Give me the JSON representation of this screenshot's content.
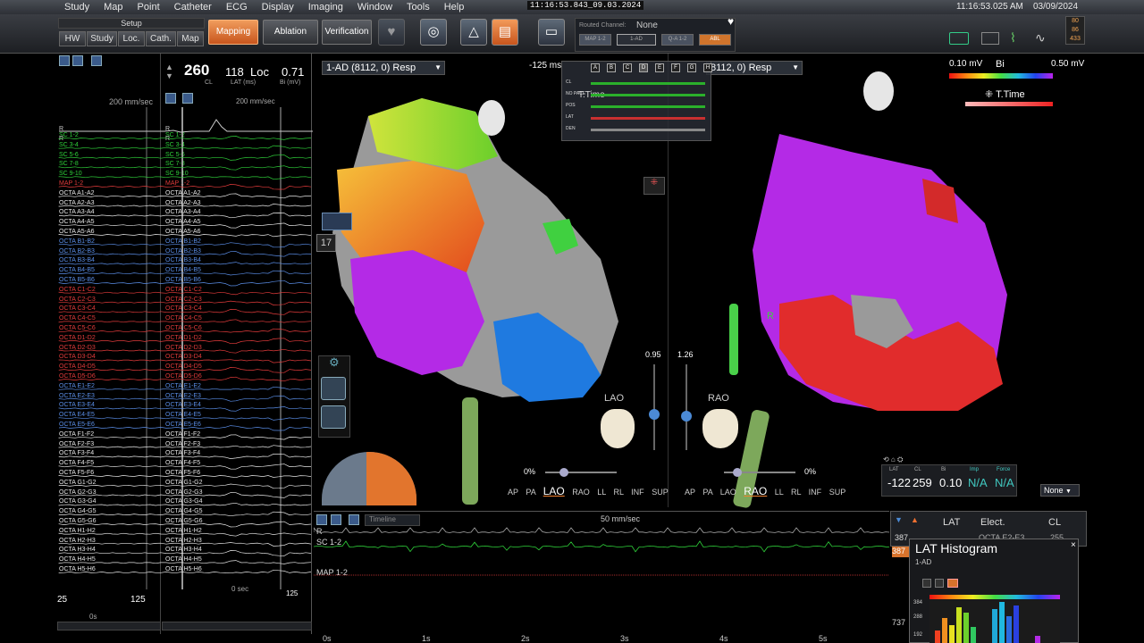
{
  "menu": [
    "Study",
    "Map",
    "Point",
    "Catheter",
    "ECG",
    "Display",
    "Imaging",
    "Window",
    "Tools",
    "Help"
  ],
  "clock_center": "11:16:53.843_09.03.2024",
  "clock_right": "11:16:53.025 AM",
  "date_right": "03/09/2024",
  "toolbar": {
    "setup": "Setup",
    "nav": [
      "HW",
      "Study",
      "Loc.",
      "Cath.",
      "Map"
    ],
    "modes": [
      "Mapping",
      "Ablation",
      "Verification"
    ],
    "active_mode": "Mapping",
    "routed_channel": "Routed Channel:",
    "routed_value": "None",
    "routed_buttons": [
      "MAP 1-2",
      "1-AD",
      "Q-A 1-2",
      "ABL"
    ],
    "right_badge": [
      "80",
      "86",
      "433"
    ]
  },
  "signals": {
    "left_speed": "200 mm/sec",
    "mid_speed": "200 mm/sec",
    "cl_value": "260",
    "cl_label": "CL",
    "lat_value": "118",
    "loc_label": "Loc",
    "lat_label": "LAT (ms)",
    "bi_value": "0.71",
    "bi_label": "Bi (mV)",
    "ref": "R",
    "channels": [
      "SC 1-2",
      "SC 3-4",
      "SC 5-6",
      "SC 7-8",
      "SC 9-10",
      "MAP 1-2",
      "OCTA A1-A2",
      "OCTA A2-A3",
      "OCTA A3-A4",
      "OCTA A4-A5",
      "OCTA A5-A6",
      "OCTA B1-B2",
      "OCTA B2-B3",
      "OCTA B3-B4",
      "OCTA B4-B5",
      "OCTA B5-B6",
      "OCTA C1-C2",
      "OCTA C2-C3",
      "OCTA C3-C4",
      "OCTA C4-C5",
      "OCTA C5-C6",
      "OCTA D1-D2",
      "OCTA D2-D3",
      "OCTA D3-D4",
      "OCTA D4-D5",
      "OCTA D5-D6",
      "OCTA E1-E2",
      "OCTA E2-E3",
      "OCTA E3-E4",
      "OCTA E4-E5",
      "OCTA E5-E6",
      "OCTA F1-F2",
      "OCTA F2-F3",
      "OCTA F3-F4",
      "OCTA F4-F5",
      "OCTA F5-F6",
      "OCTA G1-G2",
      "OCTA G2-G3",
      "OCTA G3-G4",
      "OCTA G4-G5",
      "OCTA G5-G6",
      "OCTA H1-H2",
      "OCTA H2-H3",
      "OCTA H3-H4",
      "OCTA H4-H5",
      "OCTA H5-H6"
    ],
    "bottom_left": "25",
    "bottom_mid": "125",
    "bottom_right": "125",
    "zero_sec": "0 sec",
    "zero_s": "0s"
  },
  "map_left": {
    "title": "1-AD (8112, 0) Resp",
    "ms_label": "-125 ms",
    "cath_badge": "17",
    "orientation": "LAO",
    "slider_value": "0.95",
    "percent": "0%",
    "views": [
      "AP",
      "PA",
      "LAO",
      "RAO",
      "LL",
      "RL",
      "INF",
      "SUP"
    ],
    "selected_view": "LAO"
  },
  "map_right": {
    "title": "8112, 0) Resp",
    "orientation": "RAO",
    "slider_value": "1.26",
    "percent": "0%",
    "views": [
      "AP",
      "PA",
      "LAO",
      "RAO",
      "LL",
      "RL",
      "INF",
      "SUP"
    ],
    "selected_view": "RAO",
    "scale_min": "0.10 mV",
    "scale_label": "Bi",
    "scale_max": "0.50 mV",
    "ttime": "T.Time",
    "r_label": "R"
  },
  "filter_panel": {
    "ttime": "T.Time",
    "cols": [
      "A",
      "B",
      "C",
      "D",
      "E",
      "F",
      "G",
      "H"
    ],
    "rows": [
      "CL",
      "NO PACE",
      "POS",
      "LAT",
      "DEN"
    ]
  },
  "stats": {
    "labels": [
      "LAT",
      "CL",
      "Bi",
      "Imp",
      "Force"
    ],
    "values": [
      "-122",
      "259",
      "0.10",
      "N/A",
      "N/A"
    ],
    "none_dd": "None"
  },
  "strip": {
    "speed": "50 mm/sec",
    "ref": "R",
    "sc": "SC 1-2",
    "map": "MAP 1-2",
    "timeline_label": "Timeline",
    "ticks": [
      "0s",
      "1s",
      "2s",
      "3s",
      "4s",
      "5s"
    ]
  },
  "lat_table": {
    "cols": [
      "LAT",
      "Elect.",
      "CL"
    ],
    "row_ids": [
      "387",
      "387",
      "737"
    ],
    "row_preview": "OCTA E2-E3",
    "row_cl": "255"
  },
  "lat_hist": {
    "title": "LAT Histogram",
    "subtitle": "1-AD",
    "y_ticks": [
      "384",
      "288",
      "192"
    ]
  },
  "colors": {
    "accent_orange": "#e8742c",
    "signal_green": "#2fd13a",
    "signal_red": "#e23b3b",
    "signal_yellow": "#e8d23a",
    "map_purple": "#b42ae6"
  }
}
